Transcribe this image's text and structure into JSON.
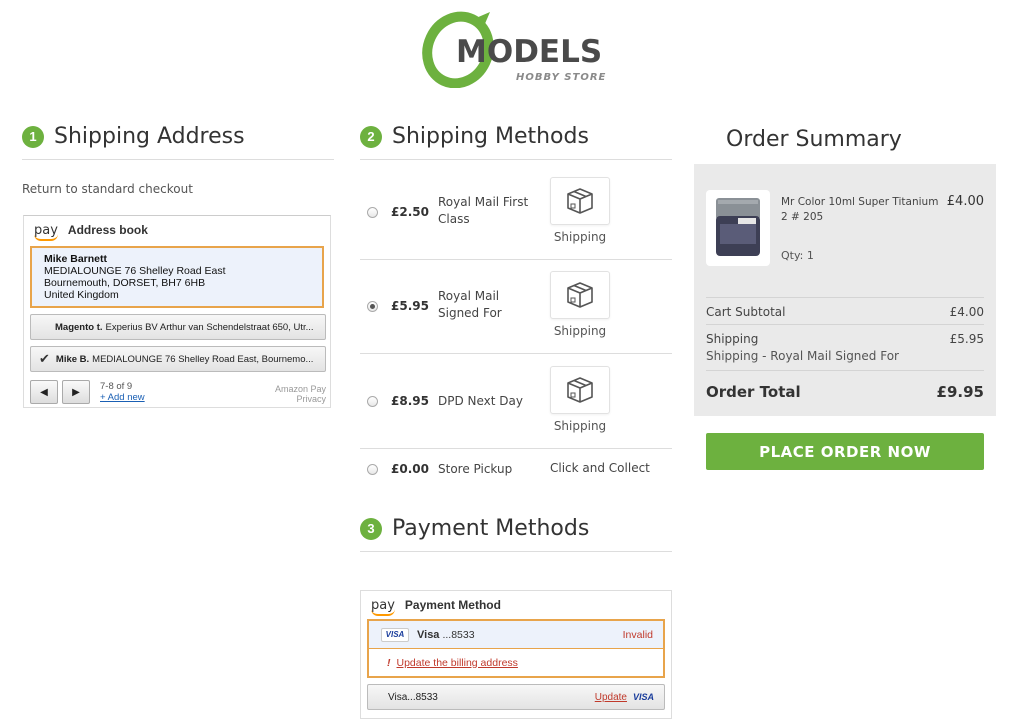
{
  "brand": {
    "logo_text": "MODELS",
    "logo_sub": "HOBBY STORE",
    "accent": "#6db13f"
  },
  "shipping_address": {
    "step": "1",
    "title": "Shipping Address",
    "return_link": "Return to standard checkout",
    "widget": {
      "pay_logo": "pay",
      "title": "Address book",
      "selected": {
        "name": "Mike Barnett",
        "line1": "MEDIALOUNGE 76 Shelley Road East",
        "line2": "Bournemouth, DORSET, BH7 6HB",
        "line3": "United Kingdom"
      },
      "options": [
        {
          "name": "Magento t.",
          "address": "Experius BV Arthur van Schendelstraat 650, Utr..."
        },
        {
          "name": "Mike B.",
          "address": "MEDIALOUNGE 76 Shelley Road East, Bournemo..."
        }
      ],
      "pager": "7-8 of 9",
      "add_new": "+ Add new",
      "footer_brand": "Amazon Pay",
      "footer_privacy": "Privacy"
    }
  },
  "shipping_methods": {
    "step": "2",
    "title": "Shipping Methods",
    "rows": [
      {
        "price": "£2.50",
        "carrier": "Royal Mail First Class",
        "label": "Shipping",
        "selected": false
      },
      {
        "price": "£5.95",
        "carrier": "Royal Mail Signed For",
        "label": "Shipping",
        "selected": true
      },
      {
        "price": "£8.95",
        "carrier": "DPD Next Day",
        "label": "Shipping",
        "selected": false
      },
      {
        "price": "£0.00",
        "carrier": "Store Pickup",
        "label": "Click and Collect",
        "selected": false
      }
    ]
  },
  "payment_methods": {
    "step": "3",
    "title": "Payment Methods",
    "widget": {
      "pay_logo": "pay",
      "title": "Payment Method",
      "selected": {
        "brand": "VISA",
        "name": "Visa",
        "digits": "...8533",
        "status": "Invalid"
      },
      "warning_icon": "!",
      "warning_link": "Update the billing address",
      "option": {
        "name": "Visa",
        "digits": "...8533",
        "action": "Update",
        "brand": "VISA"
      }
    }
  },
  "order_summary": {
    "title": "Order Summary",
    "item": {
      "name": "Mr Color 10ml Super Titanium 2 # 205",
      "price": "£4.00",
      "qty": "Qty: 1"
    },
    "subtotal_label": "Cart Subtotal",
    "subtotal_value": "£4.00",
    "shipping_label": "Shipping",
    "shipping_value": "£5.95",
    "shipping_method": "Shipping - Royal Mail Signed For",
    "total_label": "Order Total",
    "total_value": "£9.95",
    "button": "PLACE ORDER NOW"
  }
}
